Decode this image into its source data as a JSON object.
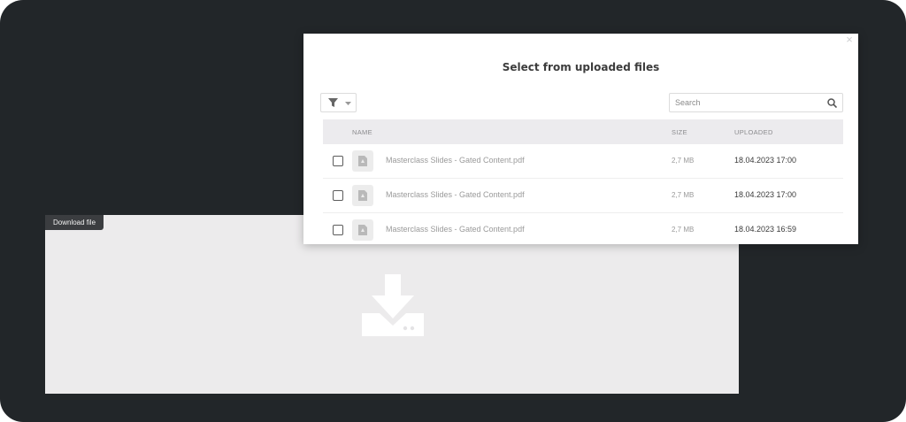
{
  "download_widget": {
    "tab_label": "Download file",
    "icon": "download-tray-icon"
  },
  "modal": {
    "title": "Select from uploaded files",
    "close_icon": "close-icon",
    "close_glyph": "×",
    "filter_icon": "filter-icon",
    "search": {
      "placeholder": "Search",
      "value": "",
      "icon": "search-icon"
    },
    "table": {
      "columns": {
        "name": "NAME",
        "size": "SIZE",
        "uploaded": "UPLOADED"
      },
      "rows": [
        {
          "name": "Masterclass Slides - Gated Content.pdf",
          "size": "2,7 MB",
          "uploaded": "18.04.2023 17:00",
          "checked": false
        },
        {
          "name": "Masterclass Slides - Gated Content.pdf",
          "size": "2,7 MB",
          "uploaded": "18.04.2023 17:00",
          "checked": false
        },
        {
          "name": "Masterclass Slides - Gated Content.pdf",
          "size": "2,7 MB",
          "uploaded": "18.04.2023 16:59",
          "checked": false
        }
      ]
    }
  },
  "colors": {
    "frame_bg": "#222629",
    "widget_bg": "#ecebec",
    "header_bg": "#ecebee",
    "title_text": "#3c3c3c"
  }
}
